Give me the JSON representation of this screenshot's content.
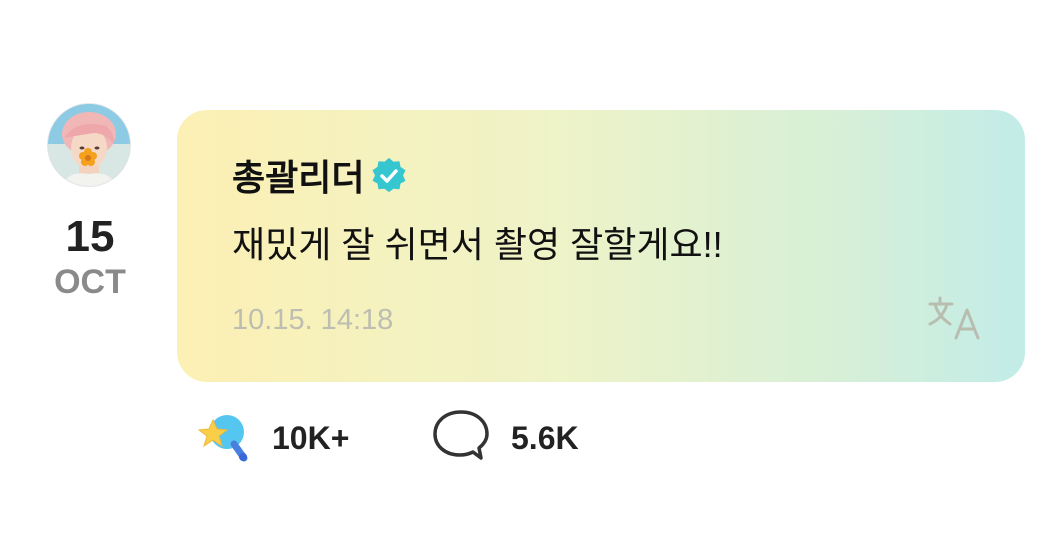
{
  "post": {
    "date": {
      "day": "15",
      "month": "OCT"
    },
    "author": {
      "name": "총괄리더",
      "verified": true
    },
    "message": "재밌게 잘 쉬면서 촬영 잘할게요!!",
    "timestamp": "10.15. 14:18",
    "icons": {
      "avatar": "profile-avatar",
      "verified": "verified-badge-icon",
      "translate": "translate-icon",
      "like": "sparkle-like-icon",
      "comment": "comment-bubble-icon"
    }
  },
  "reactions": {
    "likes": "10K+",
    "comments": "5.6K"
  },
  "colors": {
    "bubble_start": "#fcf0b4",
    "bubble_end": "#c2ece8",
    "verified": "#36c6cf",
    "timestamp": "#bdbdb2",
    "month": "#8a8a8a"
  }
}
